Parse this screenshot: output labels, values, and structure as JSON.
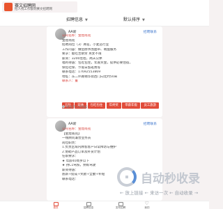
{
  "app": {
    "name": "赛文招聘网",
    "description": "招人找工作都到赛文招聘网"
  },
  "filters": [
    {
      "label": "招聘信息"
    },
    {
      "label": "默认排序"
    }
  ],
  "posts": [
    {
      "user": "AA新",
      "contact_label": "招聘联系",
      "lines": [
        {
          "text": "公司名称：金煌南苑",
          "red": true
        },
        {
          "text": "金煌南苑",
          "red": false
        },
        {
          "text": "招聘岗位（3）两名，小麦店行业",
          "red": false
        },
        {
          "text": "工作内容：做后厨水围面带、端盘服务",
          "red": false
        },
        {
          "text": "要求：能吃苦耐劳 男女不限",
          "red": false
        },
        {
          "text": "薪资：3200左右，两天公休",
          "red": false
        },
        {
          "text": "福利待遇：包吃包住，年底奖金，提供必要住宿，",
          "red": false
        },
        {
          "text": "保险社保、节假日加班费等",
          "red": false
        },
        {
          "text": "联系电话：17692553869",
          "red": false
        },
        {
          "text": "地址：东二环路锦华街西门向北约50米",
          "red": false
        },
        {
          "text": "联系人：董",
          "red": true
        }
      ],
      "tags": [
        "五险",
        "双休",
        "包吃包住",
        "年终奖",
        "带薪年假",
        "员工旅游"
      ],
      "location": "邢台市二环地段"
    },
    {
      "user": "AA新",
      "contact_label": "招聘联系",
      "lines": [
        {
          "text": "公司名称：金煌南苑",
          "red": true
        },
        {
          "text": "【金煌南苑】",
          "red": false
        },
        {
          "text": "一线顾问兼营业务员",
          "red": false
        },
        {
          "text": "岗位职责：",
          "red": false
        },
        {
          "text": "1.负责区域内顾客客户日常拜访与维护",
          "red": false
        },
        {
          "text": "2.协助产品订单及补货计划",
          "red": false
        },
        {
          "text": "任职要求：",
          "red": false
        },
        {
          "text": "★ 年龄40周岁以下",
          "red": false
        },
        {
          "text": "★ 持C1驾照，熟练驾驶",
          "red": false
        },
        {
          "text": "薪资待遇：",
          "red": false
        },
        {
          "text": "底薪+提成+奖励+全勤+补贴",
          "red": false
        },
        {
          "text": "联系电话：",
          "red": false
        }
      ]
    }
  ],
  "watermark": {
    "title": "自动秒收录",
    "slogan": "← 放上链接 ← 来访一次 ← 自动收录 →"
  },
  "nav": [
    {
      "label": "首页",
      "icon": "home-icon",
      "active": true
    },
    {
      "label": "招聘信息",
      "icon": "briefcase-icon",
      "active": false
    },
    {
      "label": "发布招聘",
      "icon": "publish-icon",
      "active": false
    },
    {
      "label": "我的",
      "icon": "heart-icon",
      "active": false
    }
  ]
}
